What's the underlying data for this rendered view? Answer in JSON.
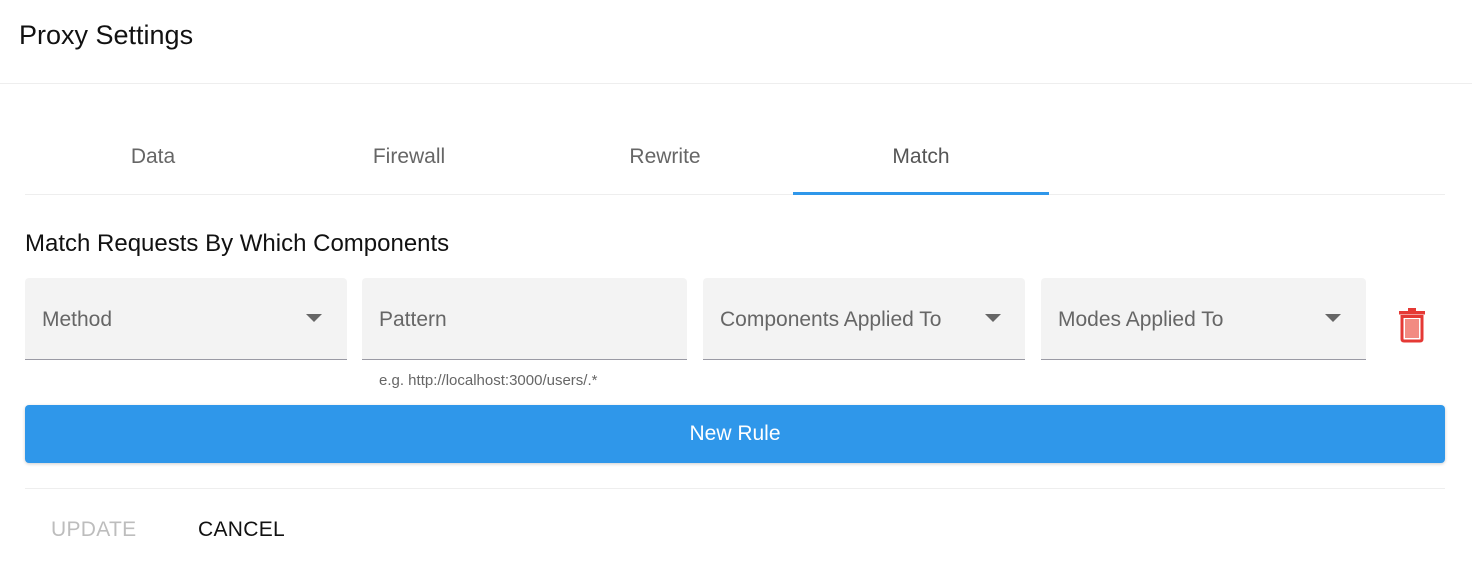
{
  "dialog": {
    "title": "Proxy Settings"
  },
  "tabs": [
    {
      "label": "Data",
      "active": false
    },
    {
      "label": "Firewall",
      "active": false
    },
    {
      "label": "Rewrite",
      "active": false
    },
    {
      "label": "Match",
      "active": true
    }
  ],
  "match": {
    "section_title": "Match Requests By Which Components",
    "fields": {
      "method": {
        "label": "Method",
        "type": "select"
      },
      "pattern": {
        "label": "Pattern",
        "type": "text",
        "helper": "e.g. http://localhost:3000/users/.*"
      },
      "components": {
        "label": "Components Applied To",
        "type": "select"
      },
      "modes": {
        "label": "Modes Applied To",
        "type": "select"
      }
    },
    "delete_icon": "trash-icon",
    "new_rule_label": "New Rule"
  },
  "actions": {
    "update_label": "UPDATE",
    "update_disabled": true,
    "cancel_label": "CANCEL"
  },
  "colors": {
    "accent": "#2f97ea",
    "delete": "#e53935",
    "field_bg": "#f3f3f3",
    "disabled_text": "#bdbdbd"
  }
}
